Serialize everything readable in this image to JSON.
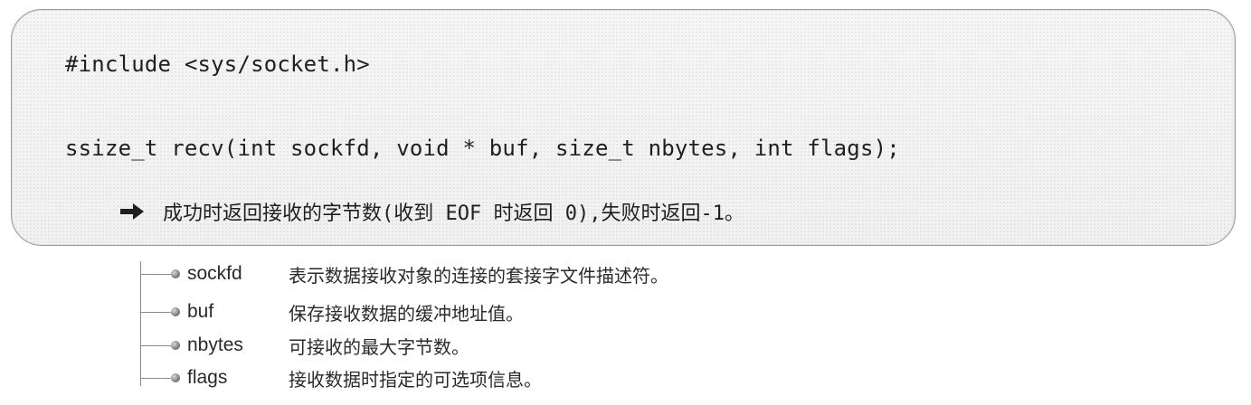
{
  "code": {
    "include_line": "#include <sys/socket.h>",
    "signature_line": "ssize_t recv(int sockfd, void * buf, size_t nbytes, int flags);",
    "return_icon": "right-arrow-icon",
    "return_text": "成功时返回接收的字节数(收到 EOF 时返回 0),失败时返回-1。"
  },
  "params": [
    {
      "name": "sockfd",
      "desc": "表示数据接收对象的连接的套接字文件描述符。"
    },
    {
      "name": "buf",
      "desc": "保存接收数据的缓冲地址值。"
    },
    {
      "name": "nbytes",
      "desc": "可接收的最大字节数。"
    },
    {
      "name": "flags",
      "desc": "接收数据时指定的可选项信息。"
    }
  ]
}
